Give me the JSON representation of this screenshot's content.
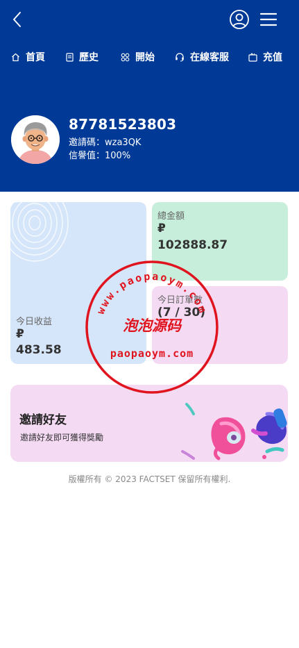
{
  "nav": {
    "items": [
      {
        "label": "首頁",
        "icon": "home-icon"
      },
      {
        "label": "歷史",
        "icon": "history-icon"
      },
      {
        "label": "開始",
        "icon": "start-grid-icon"
      },
      {
        "label": "在線客服",
        "icon": "headset-icon"
      },
      {
        "label": "充值",
        "icon": "recharge-icon"
      }
    ]
  },
  "profile": {
    "phone": "87781523803",
    "invite_code": "邀請碼：wza3QK",
    "credit": "信譽值：100%"
  },
  "stats": {
    "income_label": "今日收益",
    "income_currency": "₽",
    "income_value": "483.58",
    "total_label": "總金額",
    "total_currency": "₽",
    "total_value": "102888.87",
    "orders_label": "今日訂單數",
    "orders_value": "(7 / 30)"
  },
  "invite": {
    "title": "邀請好友",
    "desc": "邀請好友即可獲得獎勵"
  },
  "footer": {
    "copyright": "版權所有 © 2023 FACTSET 保留所有權利."
  },
  "watermark": {
    "arc_text": "www.paopaoym.com",
    "center_text": "泡泡源码",
    "bottom_text": "paopaoym.com"
  },
  "colors": {
    "header_bg": "#003a96",
    "income_card": "#d6e6fa",
    "total_card": "#c7eedb",
    "orders_card": "#f5daf4",
    "invite_card": "#f5daf4",
    "stamp_red": "#e0141e"
  }
}
